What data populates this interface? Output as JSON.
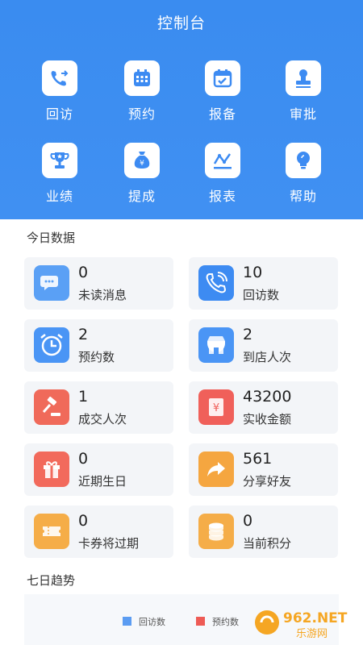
{
  "header": {
    "title": "控制台"
  },
  "menu": [
    {
      "label": "回访",
      "icon": "phone-callback-icon"
    },
    {
      "label": "预约",
      "icon": "calendar-icon"
    },
    {
      "label": "报备",
      "icon": "calendar-check-icon"
    },
    {
      "label": "审批",
      "icon": "stamp-icon"
    },
    {
      "label": "业绩",
      "icon": "trophy-icon"
    },
    {
      "label": "提成",
      "icon": "money-bag-icon"
    },
    {
      "label": "报表",
      "icon": "line-chart-icon"
    },
    {
      "label": "帮助",
      "icon": "lightbulb-icon"
    }
  ],
  "today": {
    "title": "今日数据",
    "cards": [
      {
        "value": "0",
        "label": "未读消息",
        "icon": "chat-icon",
        "color": "#5aa0f5"
      },
      {
        "value": "10",
        "label": "回访数",
        "icon": "phone-icon",
        "color": "#3d8bf2"
      },
      {
        "value": "2",
        "label": "预约数",
        "icon": "alarm-clock-icon",
        "color": "#4a95f5"
      },
      {
        "value": "2",
        "label": "到店人次",
        "icon": "store-icon",
        "color": "#4a95f5"
      },
      {
        "value": "1",
        "label": "成交人次",
        "icon": "gavel-icon",
        "color": "#f06a5a"
      },
      {
        "value": "43200",
        "label": "实收金额",
        "icon": "yuan-receipt-icon",
        "color": "#f0605a"
      },
      {
        "value": "0",
        "label": "近期生日",
        "icon": "gift-icon",
        "color": "#f26a5c"
      },
      {
        "value": "561",
        "label": "分享好友",
        "icon": "share-arrow-icon",
        "color": "#f5a640"
      },
      {
        "value": "0",
        "label": "卡券将过期",
        "icon": "ticket-icon",
        "color": "#f5ad48"
      },
      {
        "value": "0",
        "label": "当前积分",
        "icon": "coins-icon",
        "color": "#f5ad48"
      }
    ]
  },
  "trend": {
    "title": "七日趋势",
    "legend": [
      {
        "label": "回访数",
        "color": "#5b9cf2"
      },
      {
        "label": "预约数",
        "color": "#ee5b55"
      }
    ]
  },
  "watermark": {
    "text": "962.NET",
    "subtext": "乐游网"
  }
}
